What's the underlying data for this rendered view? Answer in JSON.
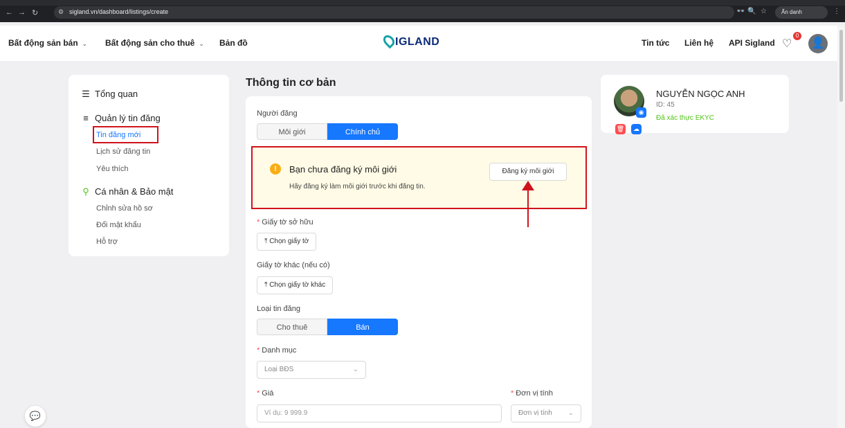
{
  "browser": {
    "url": "sigland.vn/dashboard/listings/create",
    "incognito_label": "Ẩn danh"
  },
  "header": {
    "nav": [
      "Bất động sản bán",
      "Bất động sản cho thuê",
      "Bản đồ"
    ],
    "logo_text": "IGLAND",
    "right_links": [
      "Tin tức",
      "Liên hệ",
      "API Sigland"
    ],
    "favorites_count": "0"
  },
  "sidebar": {
    "overview": "Tổng quan",
    "listings_section": "Quản lý tin đăng",
    "listings_items": [
      "Tin đăng mới",
      "Lịch sử đăng tin",
      "Yêu thích"
    ],
    "account_section": "Cá nhân & Bảo mật",
    "account_items": [
      "Chỉnh sửa hồ sơ",
      "Đổi mật khẩu",
      "Hỗ trợ"
    ]
  },
  "form": {
    "title": "Thông tin cơ bản",
    "poster_label": "Người đăng",
    "poster_options": [
      "Môi giới",
      "Chính chủ"
    ],
    "alert": {
      "title": "Bạn chưa đăng ký môi giới",
      "desc": "Hãy đăng ký làm môi giới trước khi đăng tin.",
      "button": "Đăng ký môi giới"
    },
    "ownership_label": "Giấy tờ sở hữu",
    "ownership_button": "Chọn giấy tờ",
    "other_docs_label": "Giấy tờ khác (nếu có)",
    "other_docs_button": "Chọn giấy tờ khác",
    "listing_type_label": "Loại tin đăng",
    "listing_type_options": [
      "Cho thuê",
      "Bán"
    ],
    "category_label": "Danh mục",
    "category_placeholder": "Loại BĐS",
    "price_label": "Giá",
    "price_placeholder": "Ví dụ: 9 999.9",
    "unit_label": "Đơn vị tính",
    "unit_placeholder": "Đơn vị tính"
  },
  "profile": {
    "name": "NGUYỄN NGỌC ANH",
    "id": "ID: 45",
    "status": "Đã xác thực EKYC"
  },
  "colors": {
    "primary": "#1677ff",
    "annotation_red": "#d0121b",
    "alert_bg": "#fffbe6",
    "verified_green": "#52c41a"
  }
}
